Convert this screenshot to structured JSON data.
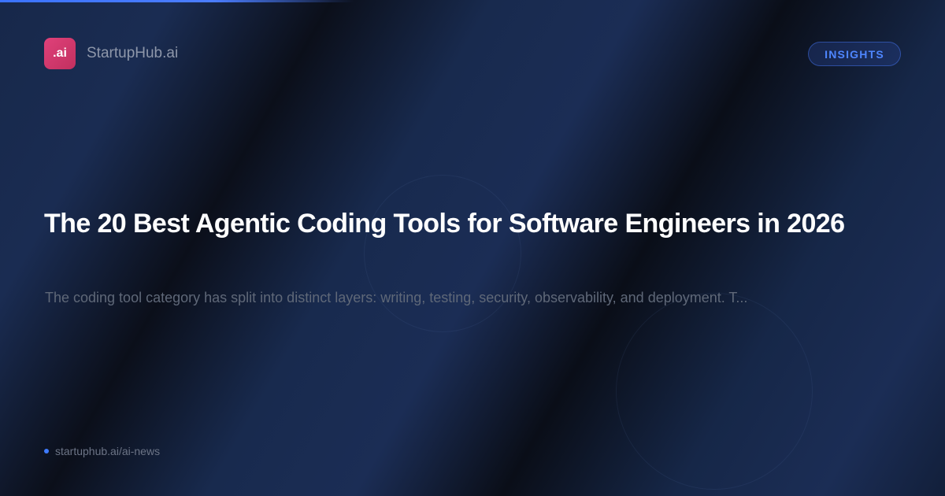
{
  "brand": {
    "logo_text": ".ai",
    "name": "StartupHub.ai",
    "logo_color": "#d23a6e"
  },
  "badge": {
    "label": "INSIGHTS",
    "color": "#4e86ff"
  },
  "article": {
    "title": "The 20 Best Agentic Coding Tools for Software Engineers in 2026",
    "description": "The coding tool category has split into distinct layers: writing, testing, security, observability, and deployment. T..."
  },
  "footer": {
    "url": "startuphub.ai/ai-news"
  },
  "colors": {
    "background": "#0d1628",
    "accent": "#3f7bff"
  }
}
